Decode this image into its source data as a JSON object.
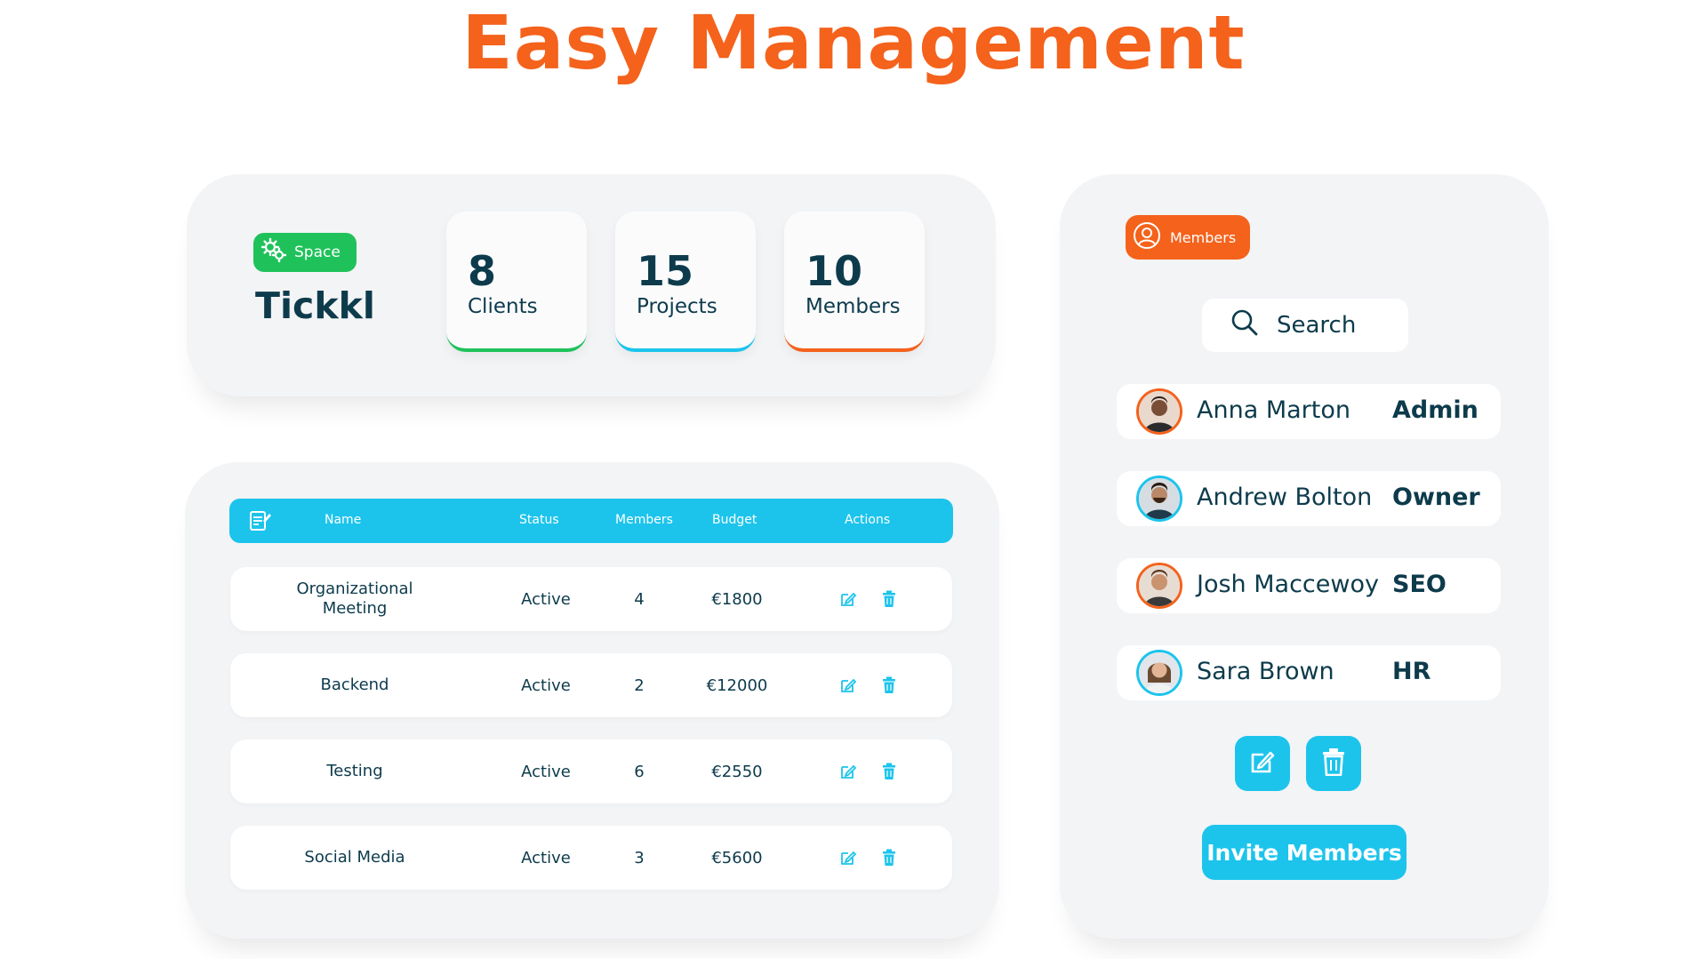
{
  "title": "Easy Management",
  "workspace": {
    "badge_label": "Space",
    "name": "Tickkl"
  },
  "stats": [
    {
      "value": "8",
      "label": "Clients",
      "accent": "#1fc25a"
    },
    {
      "value": "15",
      "label": "Projects",
      "accent": "#1cc4ec"
    },
    {
      "value": "10",
      "label": "Members",
      "accent": "#f4621c"
    }
  ],
  "table": {
    "columns": [
      "Name",
      "Status",
      "Members",
      "Budget",
      "Actions"
    ],
    "rows": [
      {
        "name": "Organizational Meeting",
        "status": "Active",
        "members": "4",
        "budget": "€1800"
      },
      {
        "name": "Backend",
        "status": "Active",
        "members": "2",
        "budget": "€12000"
      },
      {
        "name": "Testing",
        "status": "Active",
        "members": "6",
        "budget": "€2550"
      },
      {
        "name": "Social Media",
        "status": "Active",
        "members": "3",
        "budget": "€5600"
      }
    ]
  },
  "members_panel": {
    "badge_label": "Members",
    "search_placeholder": "Search",
    "members": [
      {
        "name": "Anna Marton",
        "role": "Admin",
        "ring": "#f4621c"
      },
      {
        "name": "Andrew Bolton",
        "role": "Owner",
        "ring": "#1cc4ec"
      },
      {
        "name": "Josh Maccewoy",
        "role": "SEO",
        "ring": "#f4621c"
      },
      {
        "name": "Sara Brown",
        "role": "HR",
        "ring": "#1cc4ec"
      }
    ],
    "invite_label": "Invite Members"
  },
  "colors": {
    "brand_orange": "#f4621c",
    "accent_cyan": "#1cc4ec",
    "accent_green": "#1fc25a",
    "text_dark": "#0d3b4c"
  }
}
